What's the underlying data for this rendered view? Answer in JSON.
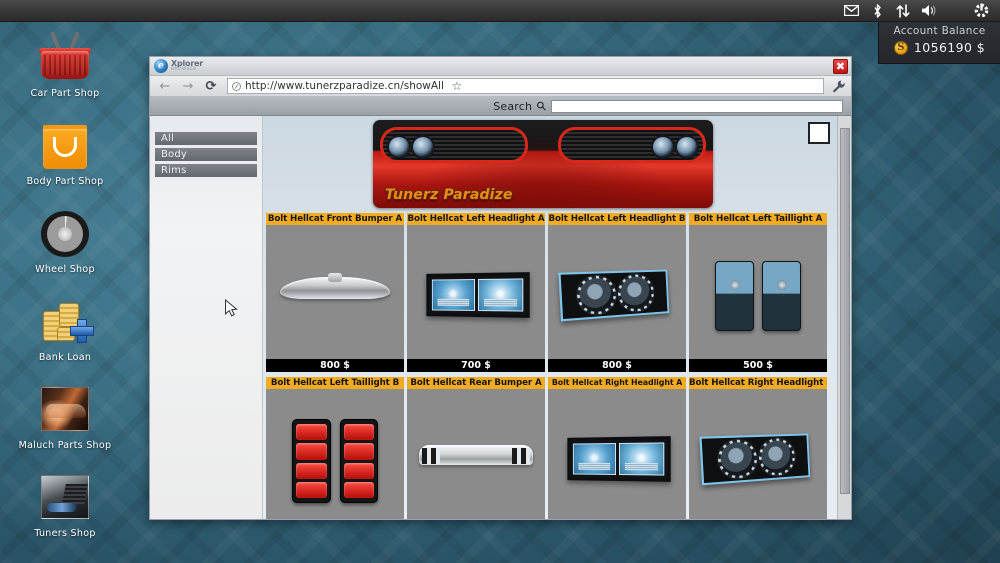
{
  "topbar": {
    "icons": [
      {
        "name": "mail-icon",
        "glyph": "✉"
      },
      {
        "name": "bluetooth-icon",
        "glyph": "ᛒ"
      },
      {
        "name": "network-transfer-icon",
        "glyph": "⇅"
      },
      {
        "name": "volume-icon",
        "glyph": "🔊"
      }
    ],
    "power_icon": "power-icon"
  },
  "account": {
    "label": "Account Balance",
    "amount": "1056190 $",
    "coin_symbol": "S"
  },
  "dock": {
    "items": [
      {
        "label": "Car Part Shop",
        "icon": "shopping-basket-icon"
      },
      {
        "label": "Body Part Shop",
        "icon": "shopping-bag-icon"
      },
      {
        "label": "Wheel Shop",
        "icon": "wheel-icon"
      },
      {
        "label": "Bank Loan",
        "icon": "coins-plus-icon"
      },
      {
        "label": "Maluch Parts Shop",
        "icon": "maluch-car-photo-icon"
      },
      {
        "label": "Tuners Shop",
        "icon": "tuner-exhaust-photo-icon"
      }
    ]
  },
  "browser": {
    "brand_name": "Xplorer",
    "brand_sub": "BROWSER",
    "close_label": "✖",
    "nav": {
      "back": "←",
      "forward": "→",
      "reload": "⟳",
      "bookmark": "☆",
      "tools": "🔧"
    },
    "url": "http://www.tunerzparadize.cn/showAll",
    "search": {
      "label": "Search",
      "value": "",
      "placeholder": ""
    }
  },
  "site": {
    "nav_links": [
      "All",
      "Body",
      "Rims"
    ],
    "banner_title": "Tunerz Paradize",
    "rows": [
      [
        {
          "title": "Bolt Hellcat Front Bumper A",
          "price": "800 $",
          "art": "bumper-front",
          "small": false
        },
        {
          "title": "Bolt Hellcat Left Headlight A",
          "price": "700 $",
          "art": "headlight-a",
          "small": false
        },
        {
          "title": "Bolt Hellcat Left Headlight B",
          "price": "800 $",
          "art": "headlight-b",
          "small": false
        },
        {
          "title": "Bolt Hellcat Left Taillight A",
          "price": "500 $",
          "art": "taillight-a",
          "small": false
        }
      ],
      [
        {
          "title": "Bolt Hellcat Left Taillight B",
          "price": "",
          "art": "taillight-b",
          "small": false
        },
        {
          "title": "Bolt Hellcat Rear Bumper A",
          "price": "",
          "art": "bumper-rear",
          "small": false
        },
        {
          "title": "Bolt Hellcat Right Headlight A",
          "price": "",
          "art": "headlight-a",
          "small": true
        },
        {
          "title": "Bolt Hellcat Right Headlight B",
          "price": "",
          "art": "headlight-b",
          "small": false
        }
      ]
    ]
  }
}
